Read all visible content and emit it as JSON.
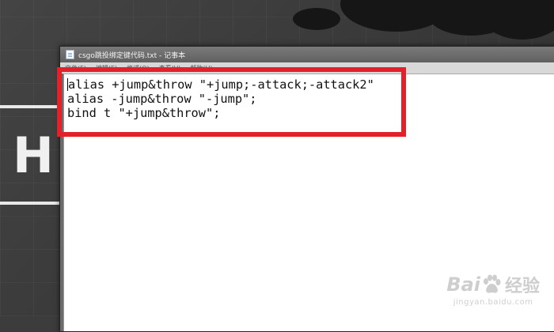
{
  "window": {
    "title": "csgo跳投绑定键代码.txt - 记事本",
    "menu": [
      "文件(F)",
      "编辑(E)",
      "格式(O)",
      "查看(V)",
      "帮助(H)"
    ]
  },
  "editor": {
    "lines": [
      "alias +jump&throw \"+jump;-attack;-attack2\"",
      "alias -jump&throw \"-jump\";",
      "bind t \"+jump&throw\";"
    ]
  },
  "desktop": {
    "letter": "H"
  },
  "watermark": {
    "brand": "Bai",
    "brand_suffix": "经验",
    "url": "jingyan.baidu.com"
  },
  "colors": {
    "highlight": "#e2212b",
    "editor_bg": "#ffffff",
    "titlebar": "#6b6b6b"
  }
}
